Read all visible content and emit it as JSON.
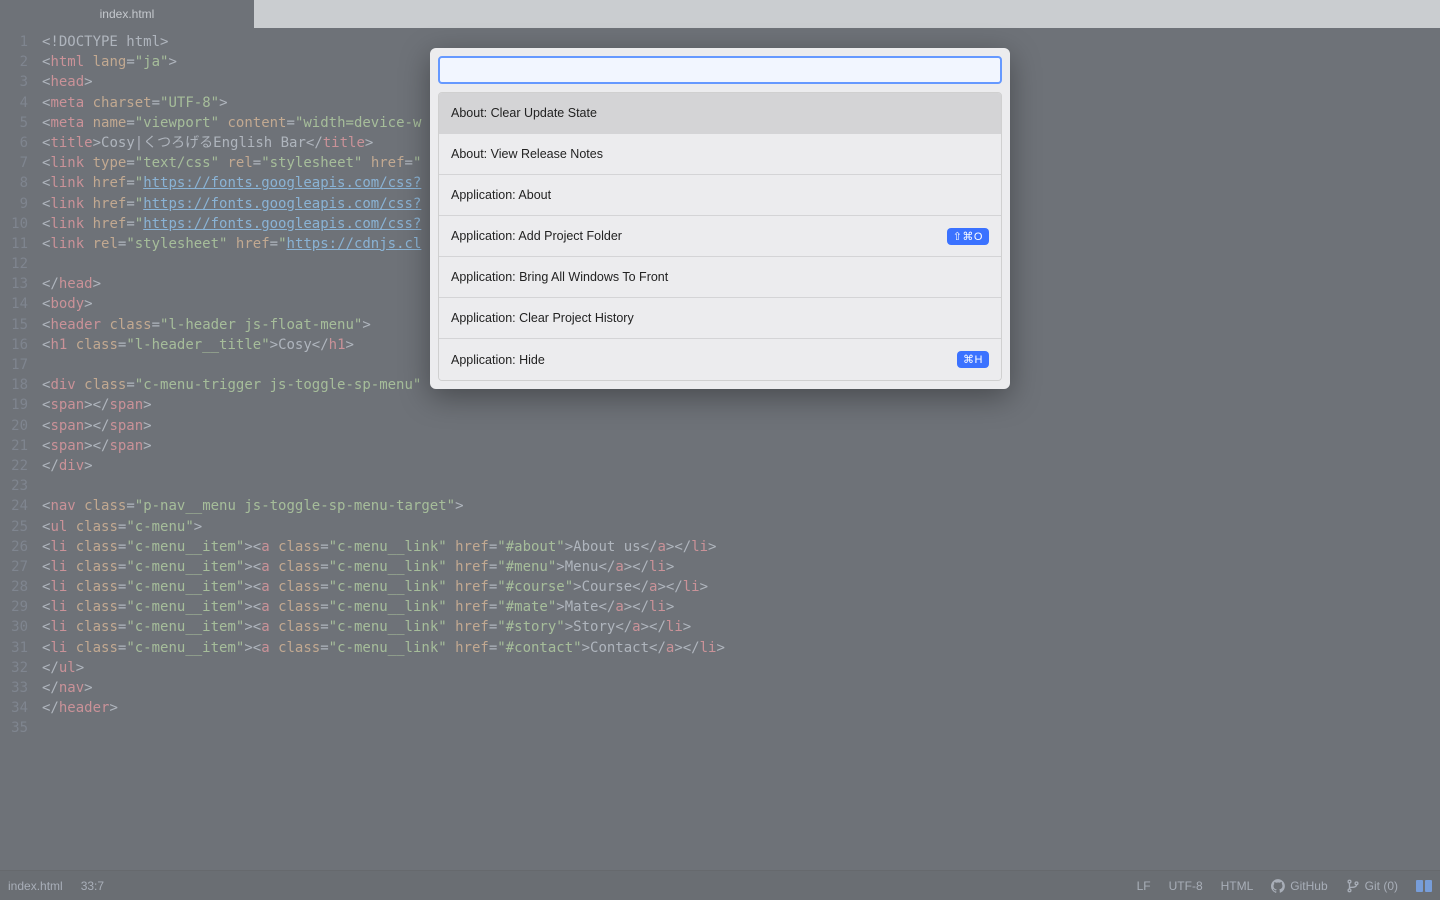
{
  "tab": {
    "title": "index.html"
  },
  "code_lines": [
    [
      [
        "c-punc",
        "<!"
      ],
      [
        "c-doct",
        "DOCTYPE html"
      ],
      [
        "c-punc",
        ">"
      ]
    ],
    [
      [
        "c-punc",
        "<"
      ],
      [
        "c-tag",
        "html"
      ],
      [
        "c-punc",
        " "
      ],
      [
        "c-attr",
        "lang"
      ],
      [
        "c-punc",
        "="
      ],
      [
        "c-str",
        "\"ja\""
      ],
      [
        "c-punc",
        ">"
      ]
    ],
    [
      [
        "c-punc",
        "<"
      ],
      [
        "c-tag",
        "head"
      ],
      [
        "c-punc",
        ">"
      ]
    ],
    [
      [
        "c-punc",
        "<"
      ],
      [
        "c-tag",
        "meta"
      ],
      [
        "c-punc",
        " "
      ],
      [
        "c-attr",
        "charset"
      ],
      [
        "c-punc",
        "="
      ],
      [
        "c-str",
        "\"UTF-8\""
      ],
      [
        "c-punc",
        ">"
      ]
    ],
    [
      [
        "c-punc",
        "<"
      ],
      [
        "c-tag",
        "meta"
      ],
      [
        "c-punc",
        " "
      ],
      [
        "c-attr",
        "name"
      ],
      [
        "c-punc",
        "="
      ],
      [
        "c-str",
        "\"viewport\""
      ],
      [
        "c-punc",
        " "
      ],
      [
        "c-attr",
        "content"
      ],
      [
        "c-punc",
        "="
      ],
      [
        "c-str",
        "\"width=device-w"
      ]
    ],
    [
      [
        "c-punc",
        "<"
      ],
      [
        "c-tag",
        "title"
      ],
      [
        "c-punc",
        ">"
      ],
      [
        "c-text",
        "Cosy|くつろげるEnglish Bar"
      ],
      [
        "c-punc",
        "</"
      ],
      [
        "c-tag",
        "title"
      ],
      [
        "c-punc",
        ">"
      ]
    ],
    [
      [
        "c-punc",
        "<"
      ],
      [
        "c-tag",
        "link"
      ],
      [
        "c-punc",
        " "
      ],
      [
        "c-attr",
        "type"
      ],
      [
        "c-punc",
        "="
      ],
      [
        "c-str",
        "\"text/css\""
      ],
      [
        "c-punc",
        " "
      ],
      [
        "c-attr",
        "rel"
      ],
      [
        "c-punc",
        "="
      ],
      [
        "c-str",
        "\"stylesheet\""
      ],
      [
        "c-punc",
        " "
      ],
      [
        "c-attr",
        "href"
      ],
      [
        "c-punc",
        "="
      ],
      [
        "c-str",
        "\""
      ]
    ],
    [
      [
        "c-punc",
        "<"
      ],
      [
        "c-tag",
        "link"
      ],
      [
        "c-punc",
        " "
      ],
      [
        "c-attr",
        "href"
      ],
      [
        "c-punc",
        "="
      ],
      [
        "c-str",
        "\""
      ],
      [
        "c-link",
        "https://fonts.googleapis.com/css?"
      ]
    ],
    [
      [
        "c-punc",
        "<"
      ],
      [
        "c-tag",
        "link"
      ],
      [
        "c-punc",
        " "
      ],
      [
        "c-attr",
        "href"
      ],
      [
        "c-punc",
        "="
      ],
      [
        "c-str",
        "\""
      ],
      [
        "c-link",
        "https://fonts.googleapis.com/css?"
      ]
    ],
    [
      [
        "c-punc",
        "<"
      ],
      [
        "c-tag",
        "link"
      ],
      [
        "c-punc",
        " "
      ],
      [
        "c-attr",
        "href"
      ],
      [
        "c-punc",
        "="
      ],
      [
        "c-str",
        "\""
      ],
      [
        "c-link",
        "https://fonts.googleapis.com/css?"
      ]
    ],
    [
      [
        "c-punc",
        "<"
      ],
      [
        "c-tag",
        "link"
      ],
      [
        "c-punc",
        " "
      ],
      [
        "c-attr",
        "rel"
      ],
      [
        "c-punc",
        "="
      ],
      [
        "c-str",
        "\"stylesheet\""
      ],
      [
        "c-punc",
        " "
      ],
      [
        "c-attr",
        "href"
      ],
      [
        "c-punc",
        "="
      ],
      [
        "c-str",
        "\""
      ],
      [
        "c-link",
        "https://cdnjs.cl"
      ]
    ],
    [],
    [
      [
        "c-punc",
        "</"
      ],
      [
        "c-tag",
        "head"
      ],
      [
        "c-punc",
        ">"
      ]
    ],
    [
      [
        "c-punc",
        "<"
      ],
      [
        "c-tag",
        "body"
      ],
      [
        "c-punc",
        ">"
      ]
    ],
    [
      [
        "c-punc",
        "<"
      ],
      [
        "c-tag",
        "header"
      ],
      [
        "c-punc",
        " "
      ],
      [
        "c-attr",
        "class"
      ],
      [
        "c-punc",
        "="
      ],
      [
        "c-str",
        "\"l-header js-float-menu\""
      ],
      [
        "c-punc",
        ">"
      ]
    ],
    [
      [
        "c-punc",
        "<"
      ],
      [
        "c-tag",
        "h1"
      ],
      [
        "c-punc",
        " "
      ],
      [
        "c-attr",
        "class"
      ],
      [
        "c-punc",
        "="
      ],
      [
        "c-str",
        "\"l-header__title\""
      ],
      [
        "c-punc",
        ">"
      ],
      [
        "c-text",
        "Cosy"
      ],
      [
        "c-punc",
        "</"
      ],
      [
        "c-tag",
        "h1"
      ],
      [
        "c-punc",
        ">"
      ]
    ],
    [],
    [
      [
        "c-punc",
        "<"
      ],
      [
        "c-tag",
        "div"
      ],
      [
        "c-punc",
        " "
      ],
      [
        "c-attr",
        "class"
      ],
      [
        "c-punc",
        "="
      ],
      [
        "c-str",
        "\"c-menu-trigger js-toggle-sp-menu\""
      ]
    ],
    [
      [
        "c-punc",
        "<"
      ],
      [
        "c-tag",
        "span"
      ],
      [
        "c-punc",
        "></"
      ],
      [
        "c-tag",
        "span"
      ],
      [
        "c-punc",
        ">"
      ]
    ],
    [
      [
        "c-punc",
        "<"
      ],
      [
        "c-tag",
        "span"
      ],
      [
        "c-punc",
        "></"
      ],
      [
        "c-tag",
        "span"
      ],
      [
        "c-punc",
        ">"
      ]
    ],
    [
      [
        "c-punc",
        "<"
      ],
      [
        "c-tag",
        "span"
      ],
      [
        "c-punc",
        "></"
      ],
      [
        "c-tag",
        "span"
      ],
      [
        "c-punc",
        ">"
      ]
    ],
    [
      [
        "c-punc",
        "</"
      ],
      [
        "c-tag",
        "div"
      ],
      [
        "c-punc",
        ">"
      ]
    ],
    [],
    [
      [
        "c-punc",
        "<"
      ],
      [
        "c-tag",
        "nav"
      ],
      [
        "c-punc",
        " "
      ],
      [
        "c-attr",
        "class"
      ],
      [
        "c-punc",
        "="
      ],
      [
        "c-str",
        "\"p-nav__menu js-toggle-sp-menu-target\""
      ],
      [
        "c-punc",
        ">"
      ]
    ],
    [
      [
        "c-punc",
        "<"
      ],
      [
        "c-tag",
        "ul"
      ],
      [
        "c-punc",
        " "
      ],
      [
        "c-attr",
        "class"
      ],
      [
        "c-punc",
        "="
      ],
      [
        "c-str",
        "\"c-menu\""
      ],
      [
        "c-punc",
        ">"
      ]
    ],
    [
      [
        "c-punc",
        "<"
      ],
      [
        "c-tag",
        "li"
      ],
      [
        "c-punc",
        " "
      ],
      [
        "c-attr",
        "class"
      ],
      [
        "c-punc",
        "="
      ],
      [
        "c-str",
        "\"c-menu__item\""
      ],
      [
        "c-punc",
        "><"
      ],
      [
        "c-tag",
        "a"
      ],
      [
        "c-punc",
        " "
      ],
      [
        "c-attr",
        "class"
      ],
      [
        "c-punc",
        "="
      ],
      [
        "c-str",
        "\"c-menu__link\""
      ],
      [
        "c-punc",
        " "
      ],
      [
        "c-attr",
        "href"
      ],
      [
        "c-punc",
        "="
      ],
      [
        "c-str",
        "\"#about\""
      ],
      [
        "c-punc",
        ">"
      ],
      [
        "c-text",
        "About us"
      ],
      [
        "c-punc",
        "</"
      ],
      [
        "c-tag",
        "a"
      ],
      [
        "c-punc",
        "></"
      ],
      [
        "c-tag",
        "li"
      ],
      [
        "c-punc",
        ">"
      ]
    ],
    [
      [
        "c-punc",
        "<"
      ],
      [
        "c-tag",
        "li"
      ],
      [
        "c-punc",
        " "
      ],
      [
        "c-attr",
        "class"
      ],
      [
        "c-punc",
        "="
      ],
      [
        "c-str",
        "\"c-menu__item\""
      ],
      [
        "c-punc",
        "><"
      ],
      [
        "c-tag",
        "a"
      ],
      [
        "c-punc",
        " "
      ],
      [
        "c-attr",
        "class"
      ],
      [
        "c-punc",
        "="
      ],
      [
        "c-str",
        "\"c-menu__link\""
      ],
      [
        "c-punc",
        " "
      ],
      [
        "c-attr",
        "href"
      ],
      [
        "c-punc",
        "="
      ],
      [
        "c-str",
        "\"#menu\""
      ],
      [
        "c-punc",
        ">"
      ],
      [
        "c-text",
        "Menu"
      ],
      [
        "c-punc",
        "</"
      ],
      [
        "c-tag",
        "a"
      ],
      [
        "c-punc",
        "></"
      ],
      [
        "c-tag",
        "li"
      ],
      [
        "c-punc",
        ">"
      ]
    ],
    [
      [
        "c-punc",
        "<"
      ],
      [
        "c-tag",
        "li"
      ],
      [
        "c-punc",
        " "
      ],
      [
        "c-attr",
        "class"
      ],
      [
        "c-punc",
        "="
      ],
      [
        "c-str",
        "\"c-menu__item\""
      ],
      [
        "c-punc",
        "><"
      ],
      [
        "c-tag",
        "a"
      ],
      [
        "c-punc",
        " "
      ],
      [
        "c-attr",
        "class"
      ],
      [
        "c-punc",
        "="
      ],
      [
        "c-str",
        "\"c-menu__link\""
      ],
      [
        "c-punc",
        " "
      ],
      [
        "c-attr",
        "href"
      ],
      [
        "c-punc",
        "="
      ],
      [
        "c-str",
        "\"#course\""
      ],
      [
        "c-punc",
        ">"
      ],
      [
        "c-text",
        "Course"
      ],
      [
        "c-punc",
        "</"
      ],
      [
        "c-tag",
        "a"
      ],
      [
        "c-punc",
        "></"
      ],
      [
        "c-tag",
        "li"
      ],
      [
        "c-punc",
        ">"
      ]
    ],
    [
      [
        "c-punc",
        "<"
      ],
      [
        "c-tag",
        "li"
      ],
      [
        "c-punc",
        " "
      ],
      [
        "c-attr",
        "class"
      ],
      [
        "c-punc",
        "="
      ],
      [
        "c-str",
        "\"c-menu__item\""
      ],
      [
        "c-punc",
        "><"
      ],
      [
        "c-tag",
        "a"
      ],
      [
        "c-punc",
        " "
      ],
      [
        "c-attr",
        "class"
      ],
      [
        "c-punc",
        "="
      ],
      [
        "c-str",
        "\"c-menu__link\""
      ],
      [
        "c-punc",
        " "
      ],
      [
        "c-attr",
        "href"
      ],
      [
        "c-punc",
        "="
      ],
      [
        "c-str",
        "\"#mate\""
      ],
      [
        "c-punc",
        ">"
      ],
      [
        "c-text",
        "Mate"
      ],
      [
        "c-punc",
        "</"
      ],
      [
        "c-tag",
        "a"
      ],
      [
        "c-punc",
        "></"
      ],
      [
        "c-tag",
        "li"
      ],
      [
        "c-punc",
        ">"
      ]
    ],
    [
      [
        "c-punc",
        "<"
      ],
      [
        "c-tag",
        "li"
      ],
      [
        "c-punc",
        " "
      ],
      [
        "c-attr",
        "class"
      ],
      [
        "c-punc",
        "="
      ],
      [
        "c-str",
        "\"c-menu__item\""
      ],
      [
        "c-punc",
        "><"
      ],
      [
        "c-tag",
        "a"
      ],
      [
        "c-punc",
        " "
      ],
      [
        "c-attr",
        "class"
      ],
      [
        "c-punc",
        "="
      ],
      [
        "c-str",
        "\"c-menu__link\""
      ],
      [
        "c-punc",
        " "
      ],
      [
        "c-attr",
        "href"
      ],
      [
        "c-punc",
        "="
      ],
      [
        "c-str",
        "\"#story\""
      ],
      [
        "c-punc",
        ">"
      ],
      [
        "c-text",
        "Story"
      ],
      [
        "c-punc",
        "</"
      ],
      [
        "c-tag",
        "a"
      ],
      [
        "c-punc",
        "></"
      ],
      [
        "c-tag",
        "li"
      ],
      [
        "c-punc",
        ">"
      ]
    ],
    [
      [
        "c-punc",
        "<"
      ],
      [
        "c-tag",
        "li"
      ],
      [
        "c-punc",
        " "
      ],
      [
        "c-attr",
        "class"
      ],
      [
        "c-punc",
        "="
      ],
      [
        "c-str",
        "\"c-menu__item\""
      ],
      [
        "c-punc",
        "><"
      ],
      [
        "c-tag",
        "a"
      ],
      [
        "c-punc",
        " "
      ],
      [
        "c-attr",
        "class"
      ],
      [
        "c-punc",
        "="
      ],
      [
        "c-str",
        "\"c-menu__link\""
      ],
      [
        "c-punc",
        " "
      ],
      [
        "c-attr",
        "href"
      ],
      [
        "c-punc",
        "="
      ],
      [
        "c-str",
        "\"#contact\""
      ],
      [
        "c-punc",
        ">"
      ],
      [
        "c-text",
        "Contact"
      ],
      [
        "c-punc",
        "</"
      ],
      [
        "c-tag",
        "a"
      ],
      [
        "c-punc",
        "></"
      ],
      [
        "c-tag",
        "li"
      ],
      [
        "c-punc",
        ">"
      ]
    ],
    [
      [
        "c-punc",
        "</"
      ],
      [
        "c-tag",
        "ul"
      ],
      [
        "c-punc",
        ">"
      ]
    ],
    [
      [
        "c-punc",
        "</"
      ],
      [
        "c-tag",
        "nav"
      ],
      [
        "c-punc",
        ">"
      ]
    ],
    [
      [
        "c-punc",
        "</"
      ],
      [
        "c-tag",
        "header"
      ],
      [
        "c-punc",
        ">"
      ]
    ],
    []
  ],
  "status": {
    "file": "index.html",
    "cursor": "33:7",
    "eol": "LF",
    "encoding": "UTF-8",
    "grammar": "HTML",
    "github": "GitHub",
    "git": "Git (0)"
  },
  "palette": {
    "input_value": "",
    "items": [
      {
        "label": "About: Clear Update State",
        "key": "",
        "selected": true
      },
      {
        "label": "About: View Release Notes",
        "key": "",
        "selected": false
      },
      {
        "label": "Application: About",
        "key": "",
        "selected": false
      },
      {
        "label": "Application: Add Project Folder",
        "key": "⇧⌘O",
        "selected": false
      },
      {
        "label": "Application: Bring All Windows To Front",
        "key": "",
        "selected": false
      },
      {
        "label": "Application: Clear Project History",
        "key": "",
        "selected": false
      },
      {
        "label": "Application: Hide",
        "key": "⌘H",
        "selected": false
      }
    ]
  }
}
